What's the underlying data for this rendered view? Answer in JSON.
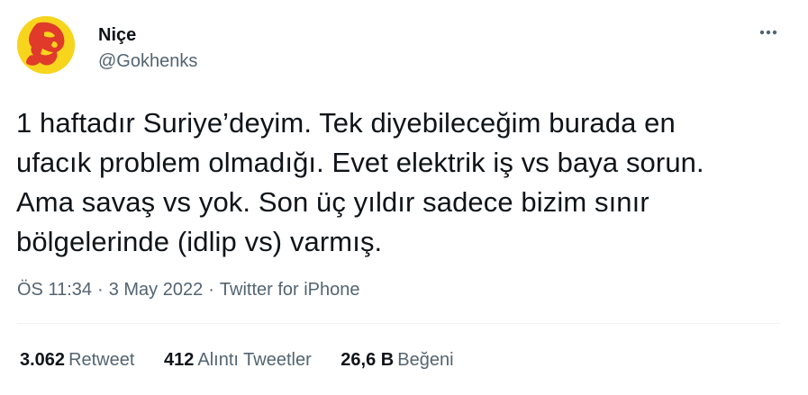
{
  "user": {
    "display_name": "Niçe",
    "handle": "@Gokhenks",
    "avatar_colors": {
      "background": "#f7d51d",
      "figure": "#e03a2b"
    }
  },
  "more_icon": "more-horizontal-icon",
  "tweet": {
    "text": "1 haftadır Suriye’deyim. Tek diyebileceğim burada en\nufacık problem olmadığı. Evet elektrik iş vs baya sorun.\nAma savaş vs yok. Son üç yıldır sadece bizim sınır\nbölgelerinde (idlip vs) varmış."
  },
  "meta": {
    "time": "ÖS 11:34",
    "separator": "·",
    "date": "3 May 2022",
    "source": "Twitter for iPhone"
  },
  "stats": {
    "retweets": {
      "count": "3.062",
      "label": "Retweet"
    },
    "quotes": {
      "count": "412",
      "label": "Alıntı Tweetler"
    },
    "likes": {
      "count": "26,6 B",
      "label": "Beğeni"
    }
  },
  "colors": {
    "text_primary": "#0f1419",
    "text_secondary": "#536471",
    "divider": "#eff3f4"
  }
}
